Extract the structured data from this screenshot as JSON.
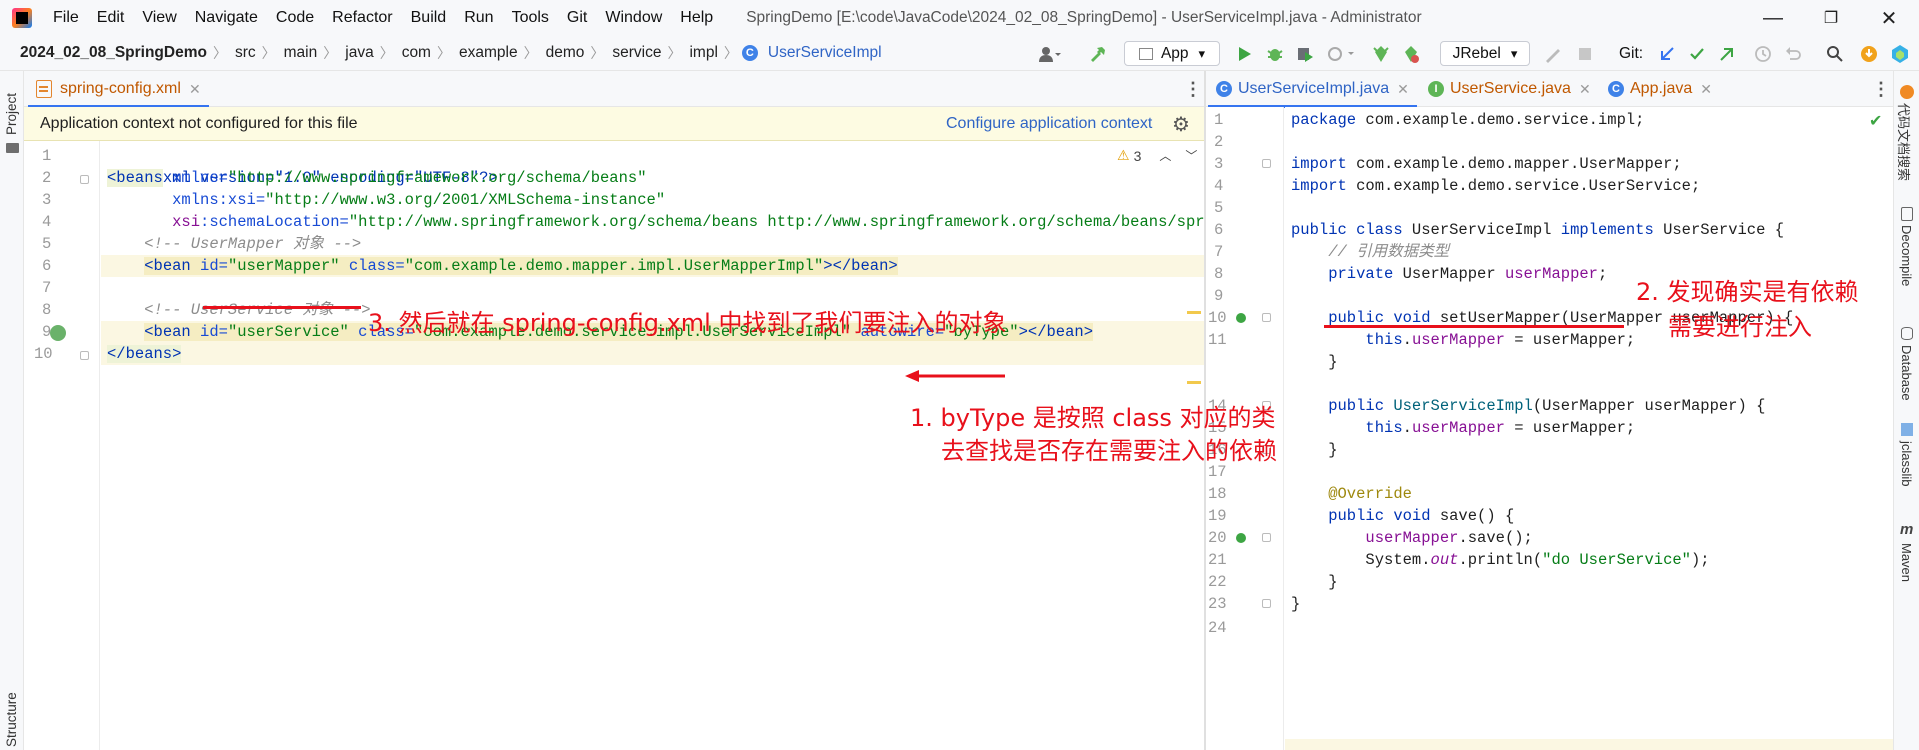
{
  "menubar": {
    "items": [
      "File",
      "Edit",
      "View",
      "Navigate",
      "Code",
      "Refactor",
      "Build",
      "Run",
      "Tools",
      "Git",
      "Window",
      "Help"
    ],
    "title": "SpringDemo [E:\\code\\JavaCode\\2024_02_08_SpringDemo] - UserServiceImpl.java - Administrator",
    "minimize": "—",
    "restore": "❐",
    "close": "✕"
  },
  "breadcrumb": {
    "project": "2024_02_08_SpringDemo",
    "parts": [
      "src",
      "main",
      "java",
      "com",
      "example",
      "demo",
      "service",
      "impl"
    ],
    "last": "UserServiceImpl",
    "sep": "〉"
  },
  "toolbar": {
    "run_config": "App",
    "jrebel": "JRebel",
    "git_label": "Git:",
    "dropdown_arrow": "▾"
  },
  "left_strip": {
    "project": "Project",
    "structure": "Structure"
  },
  "right_strip": {
    "item1": "代码文档搜索",
    "item2": "Decompile",
    "item3": "Database",
    "item4": "jclasslib",
    "item5": "Maven"
  },
  "left_editor": {
    "tab": "spring-config.xml",
    "banner_text": "Application context not configured for this file",
    "banner_link": "Configure application context",
    "warning_count": "3",
    "line_numbers": [
      "1",
      "2",
      "3",
      "4",
      "5",
      "6",
      "7",
      "8",
      "9",
      "10"
    ],
    "lines": {
      "l1": "<?xml version=\"1.0\" encoding=\"UTF-8\"?>",
      "l2_tag": "<beans",
      "l2_attr": " xmlns=",
      "l2_val": "\"http://www.springframework.org/schema/beans\"",
      "l3_pre": "       xmlns",
      "l3_ns": ":xsi",
      "l3_eq": "=",
      "l3_val": "\"http://www.w3.org/2001/XMLSchema-instance\"",
      "l4_pre": "       xsi",
      "l4_attr": ":schemaLocation=",
      "l4_val": "\"http://www.springframework.org/schema/beans http://www.springframework.org/schema/beans/spring-beans.xsd\"",
      "l5": "    <!-- UserMapper 对象 -->",
      "l6_open": "<bean ",
      "l6_idattr": "id=",
      "l6_idval": "\"userMapper\"",
      "l6_classattr": " class=",
      "l6_classval": "\"com.example.demo.mapper.impl.UserMapperImpl\"",
      "l6_close": "></bean>",
      "l8": "    <!-- UserService 对象 -->",
      "l9_open": "<bean ",
      "l9_idattr": "id=",
      "l9_idval": "\"userService\"",
      "l9_classattr": " class=",
      "l9_classval": "\"com.example.demo.service.impl.UserServiceImpl\"",
      "l9_autowire": " autowire=",
      "l9_autoval": "\"byType\"",
      "l9_close": "></bean>",
      "l10": "</beans>"
    }
  },
  "right_editor": {
    "tabs": [
      "UserServiceImpl.java",
      "UserService.java",
      "App.java"
    ],
    "line_numbers": [
      "1",
      "2",
      "3",
      "4",
      "5",
      "6",
      "7",
      "8",
      "9",
      "10",
      "11",
      "",
      "",
      "14",
      "15",
      "16",
      "17",
      "18",
      "19",
      "20",
      "21",
      "22",
      "23",
      "24"
    ],
    "lines": {
      "l1_kw": "package",
      "l1_rest": " com.example.demo.service.impl;",
      "l3_kw": "import",
      "l3_rest": " com.example.demo.mapper.UserMapper;",
      "l4_kw": "import",
      "l4_rest": " com.example.demo.service.UserService;",
      "l6_kw1": "public class",
      "l6_name": " UserServiceImpl ",
      "l6_kw2": "implements",
      "l6_rest": " UserService {",
      "l7": "    // 引用数据类型",
      "l8_kw": "    private",
      "l8_type": " UserMapper ",
      "l8_fld": "userMapper",
      "l8_end": ";",
      "l10_kw": "    public void",
      "l10_rest": " setUserMapper(UserMapper userMapper) {",
      "l11_kw": "        this",
      "l11_dot": ".",
      "l11_fld": "userMapper",
      "l11_rest": " = userMapper;",
      "l12": "    }",
      "l14_kw": "    public",
      "l14_name": " UserServiceImpl",
      "l14_rest": "(UserMapper userMapper) {",
      "l15_kw": "        this",
      "l15_dot": ".",
      "l15_fld": "userMapper",
      "l15_rest": " = userMapper;",
      "l16": "    }",
      "l18": "    @Override",
      "l19_kw": "    public void",
      "l19_rest": " save() {",
      "l20_fld": "        userMapper",
      "l20_rest": ".save();",
      "l21_a": "        System.",
      "l21_out": "out",
      "l21_b": ".println(",
      "l21_str": "\"do UserService\"",
      "l21_c": ");",
      "l22": "    }",
      "l23": "}"
    }
  },
  "annotations": {
    "a1_line1": "1. byType 是按照 class 对应的类",
    "a1_line2": "去查找是否存在需要注入的依赖",
    "a2_line1": "2. 发现确实是有依赖",
    "a2_line2": "需要进行注入",
    "a3": "3. 然后就在 spring-config.xml 中找到了我们要注入的对象"
  },
  "colors": {
    "accent": "#3574f0",
    "annotation_red": "#e8101b",
    "banner_bg": "#fdfbe2"
  }
}
